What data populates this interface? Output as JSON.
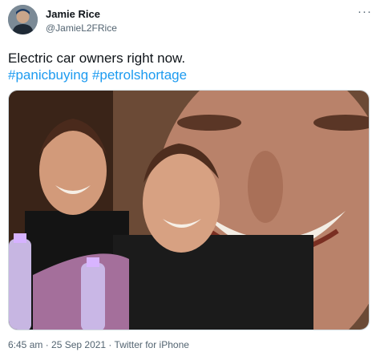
{
  "author": {
    "display_name": "Jamie Rice",
    "handle": "@JamieL2FRice"
  },
  "tweet": {
    "text": "Electric car owners right now.",
    "hashtags": [
      "#panicbuying",
      "#petrolshortage"
    ]
  },
  "menu": {
    "more_label": "···"
  },
  "meta": {
    "time": "6:45 am",
    "separator": " · ",
    "date": "25 Sep 2021",
    "source": "Twitter for iPhone"
  }
}
